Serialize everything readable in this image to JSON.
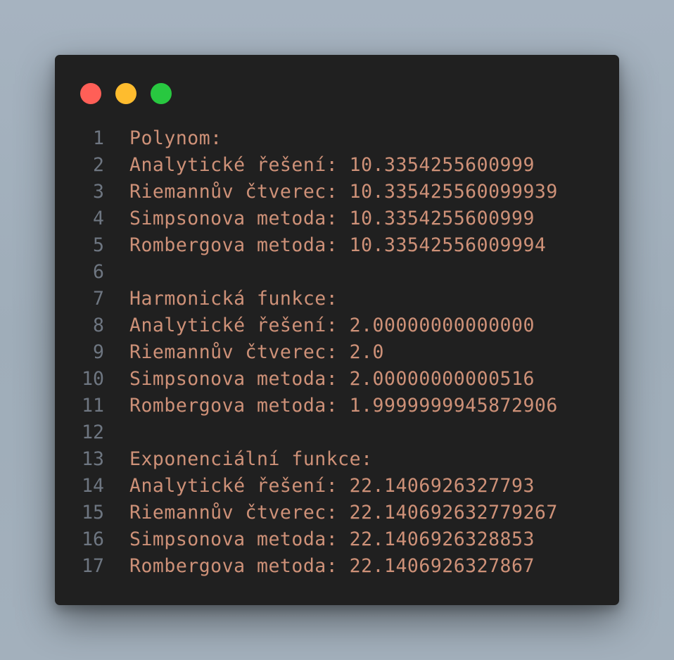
{
  "window": {
    "controls": [
      {
        "name": "close",
        "color": "#ff5f57"
      },
      {
        "name": "minimize",
        "color": "#febc2e"
      },
      {
        "name": "maximize",
        "color": "#28c840"
      }
    ]
  },
  "code": {
    "lines": [
      {
        "number": "1",
        "text": "Polynom:"
      },
      {
        "number": "2",
        "text": "Analytické řešení: 10.3354255600999"
      },
      {
        "number": "3",
        "text": "Riemannův čtverec: 10.335425560099939"
      },
      {
        "number": "4",
        "text": "Simpsonova metoda: 10.3354255600999"
      },
      {
        "number": "5",
        "text": "Rombergova metoda: 10.33542556009994"
      },
      {
        "number": "6",
        "text": ""
      },
      {
        "number": "7",
        "text": "Harmonická funkce:"
      },
      {
        "number": "8",
        "text": "Analytické řešení: 2.00000000000000"
      },
      {
        "number": "9",
        "text": "Riemannův čtverec: 2.0"
      },
      {
        "number": "10",
        "text": "Simpsonova metoda: 2.00000000000516"
      },
      {
        "number": "11",
        "text": "Rombergova metoda: 1.9999999945872906"
      },
      {
        "number": "12",
        "text": ""
      },
      {
        "number": "13",
        "text": "Exponenciální funkce:"
      },
      {
        "number": "14",
        "text": "Analytické řešení: 22.1406926327793"
      },
      {
        "number": "15",
        "text": "Riemannův čtverec: 22.140692632779267"
      },
      {
        "number": "16",
        "text": "Simpsonova metoda: 22.1406926328853"
      },
      {
        "number": "17",
        "text": "Rombergova metoda: 22.1406926327867"
      }
    ]
  },
  "colors": {
    "window_background": "#202020",
    "text": "#ce9178",
    "line_number": "#6e7681"
  }
}
